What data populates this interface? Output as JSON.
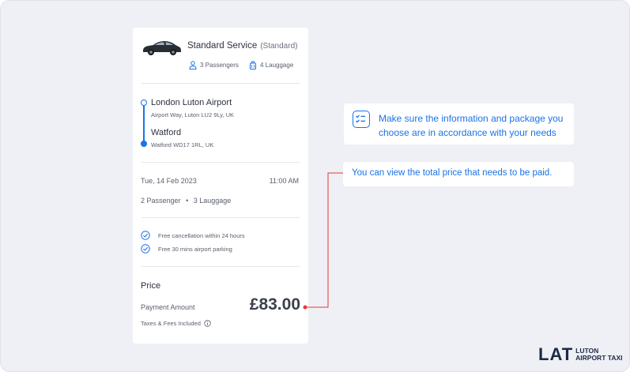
{
  "service": {
    "name": "Standard Service",
    "class": "(Standard)",
    "passengers": "3 Passengers",
    "luggage": "4 Lauggage"
  },
  "route": {
    "from_name": "London Luton Airport",
    "from_address": "Airport Way, Luton LU2 9Ly, UK",
    "to_name": "Watford",
    "to_address": "Watford WD17 1RL, UK"
  },
  "schedule": {
    "date": "Tue, 14 Feb 2023",
    "time": "11:00 AM",
    "passengers": "2 Passenger",
    "separator": "•",
    "luggage": "3 Lauggage"
  },
  "features": [
    "Free cancellation within 24 hours",
    "Free 30 mins airport parking"
  ],
  "price": {
    "title": "Price",
    "payment_label": "Payment Amount",
    "amount": "£83.00",
    "tax_note": "Taxes & Fees Included"
  },
  "tips": {
    "info": "Make sure the information and package you choose are in accordance with your needs",
    "total": "You can view the total price that needs to be paid."
  },
  "brand": {
    "mark": "LAT",
    "line1": "LUTON",
    "line2": "AIRPORT TAXI"
  },
  "colors": {
    "accent": "#1a73e8",
    "pointer": "#e53935",
    "background": "#eef0f5"
  }
}
